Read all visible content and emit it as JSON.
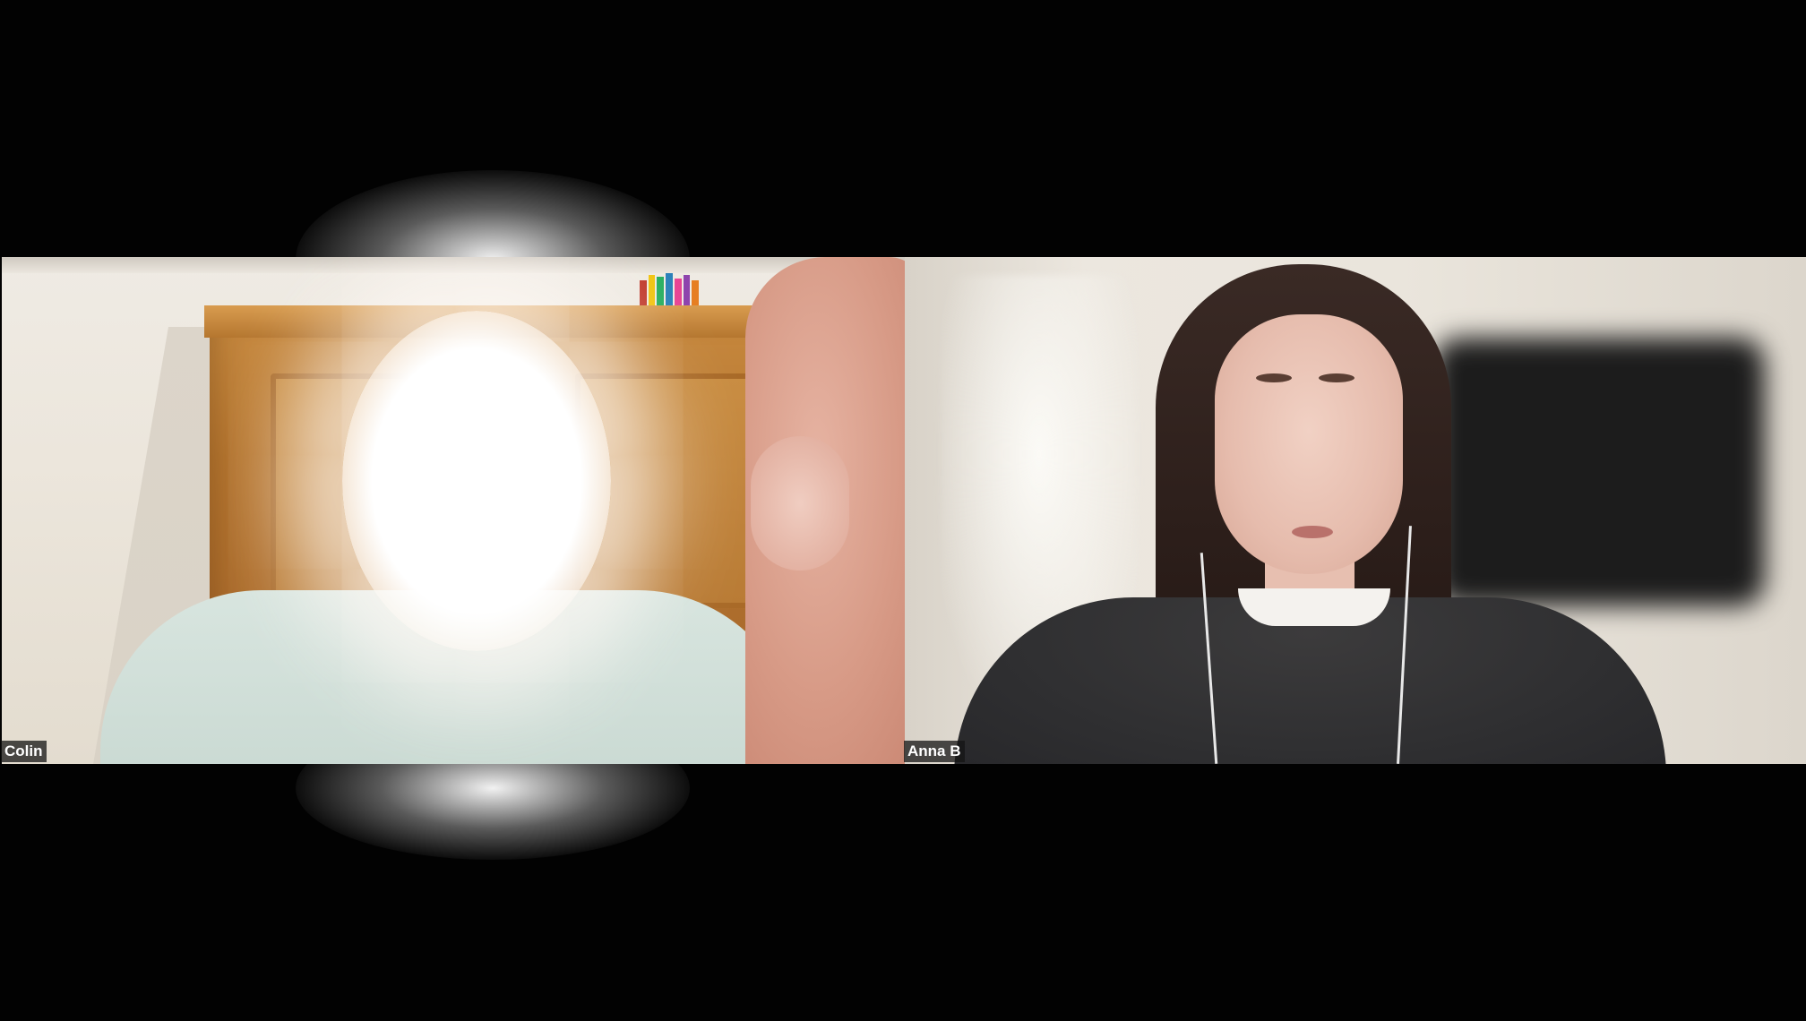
{
  "participants": [
    {
      "name": "Colin"
    },
    {
      "name": "Anna B"
    }
  ],
  "colors": {
    "background": "#020202",
    "label_background": "#141414",
    "label_text": "#ffffff"
  }
}
